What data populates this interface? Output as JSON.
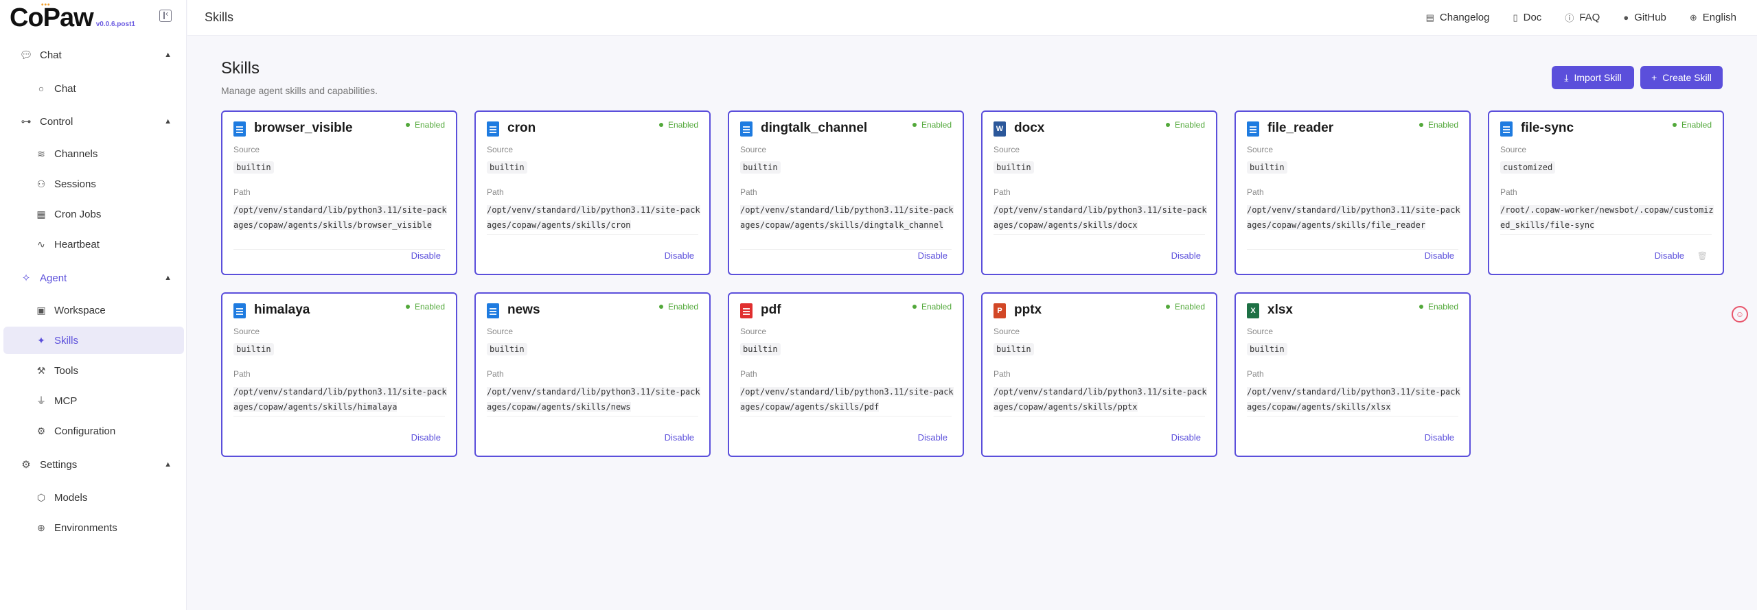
{
  "app": {
    "logo_text": "CoPaw",
    "version": "v0.0.6.post1"
  },
  "topbar": {
    "title": "Skills",
    "links": [
      {
        "label": "Changelog",
        "icon": "file-icon"
      },
      {
        "label": "Doc",
        "icon": "book-icon"
      },
      {
        "label": "FAQ",
        "icon": "help-circle-icon"
      },
      {
        "label": "GitHub",
        "icon": "github-icon"
      },
      {
        "label": "English",
        "icon": "globe-icon"
      }
    ]
  },
  "sidebar": {
    "groups": {
      "chat": {
        "label": "Chat",
        "items": {
          "chat": "Chat"
        }
      },
      "control": {
        "label": "Control",
        "items": {
          "channels": "Channels",
          "sessions": "Sessions",
          "cron_jobs": "Cron Jobs",
          "heartbeat": "Heartbeat"
        }
      },
      "agent": {
        "label": "Agent",
        "items": {
          "workspace": "Workspace",
          "skills": "Skills",
          "tools": "Tools",
          "mcp": "MCP",
          "configuration": "Configuration"
        }
      },
      "settings": {
        "label": "Settings",
        "items": {
          "models": "Models",
          "environments": "Environments"
        }
      }
    }
  },
  "main": {
    "title": "Skills",
    "subtitle": "Manage agent skills and capabilities.",
    "import_label": "Import Skill",
    "create_label": "Create Skill"
  },
  "labels": {
    "source": "Source",
    "path": "Path",
    "disable": "Disable",
    "enabled": "Enabled"
  },
  "skills": [
    {
      "name": "browser_visible",
      "status": "Enabled",
      "source": "builtin",
      "path": "/opt/venv/standard/lib/python3.11/site-packages/copaw/agents/skills/browser_visible",
      "icon_color": "#1e7be0"
    },
    {
      "name": "cron",
      "status": "Enabled",
      "source": "builtin",
      "path": "/opt/venv/standard/lib/python3.11/site-packages/copaw/agents/skills/cron",
      "icon_color": "#1e7be0"
    },
    {
      "name": "dingtalk_channel",
      "status": "Enabled",
      "source": "builtin",
      "path": "/opt/venv/standard/lib/python3.11/site-packages/copaw/agents/skills/dingtalk_channel",
      "icon_color": "#1e7be0"
    },
    {
      "name": "docx",
      "status": "Enabled",
      "source": "builtin",
      "path": "/opt/venv/standard/lib/python3.11/site-packages/copaw/agents/skills/docx",
      "icon_color": "#2b579a",
      "icon_letter": "W"
    },
    {
      "name": "file_reader",
      "status": "Enabled",
      "source": "builtin",
      "path": "/opt/venv/standard/lib/python3.11/site-packages/copaw/agents/skills/file_reader",
      "icon_color": "#1e7be0"
    },
    {
      "name": "file-sync",
      "status": "Enabled",
      "source": "customized",
      "path": "/root/.copaw-worker/newsbot/.copaw/customized_skills/file-sync",
      "icon_color": "#1e7be0"
    },
    {
      "name": "himalaya",
      "status": "Enabled",
      "source": "builtin",
      "path": "/opt/venv/standard/lib/python3.11/site-packages/copaw/agents/skills/himalaya",
      "icon_color": "#1e7be0"
    },
    {
      "name": "news",
      "status": "Enabled",
      "source": "builtin",
      "path": "/opt/venv/standard/lib/python3.11/site-packages/copaw/agents/skills/news",
      "icon_color": "#1e7be0"
    },
    {
      "name": "pdf",
      "status": "Enabled",
      "source": "builtin",
      "path": "/opt/venv/standard/lib/python3.11/site-packages/copaw/agents/skills/pdf",
      "icon_color": "#e02f2f"
    },
    {
      "name": "pptx",
      "status": "Enabled",
      "source": "builtin",
      "path": "/opt/venv/standard/lib/python3.11/site-packages/copaw/agents/skills/pptx",
      "icon_color": "#d24726",
      "icon_letter": "P"
    },
    {
      "name": "xlsx",
      "status": "Enabled",
      "source": "builtin",
      "path": "/opt/venv/standard/lib/python3.11/site-packages/copaw/agents/skills/xlsx",
      "icon_color": "#1d7044",
      "icon_letter": "X"
    }
  ]
}
